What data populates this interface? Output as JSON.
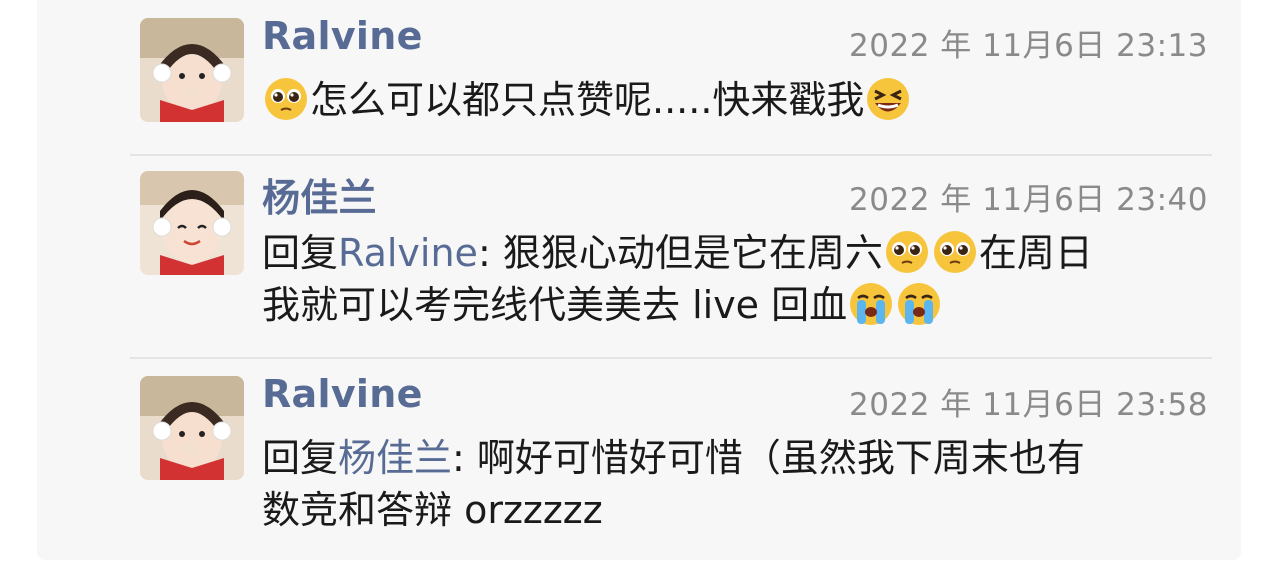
{
  "comments": [
    {
      "name": "Ralvine",
      "time": "2022 年 11月6日 23:13",
      "avatar": "boy-with-earmuffs-avatar",
      "line1": "怎么可以都只点赞呢.....快来戳我",
      "emojis": [
        "pleading-face-emoji",
        "laughing-squint-face-emoji"
      ]
    },
    {
      "name": "杨佳兰",
      "time": "2022 年 11月6日 23:40",
      "avatar": "girl-with-earmuffs-avatar",
      "reply_prefix": "回复",
      "reply_to": "Ralvine",
      "line1": ": 狠狠心动但是它在周六",
      "line1b": "在周日",
      "line2": "我就可以考完线代美美去 live 回血",
      "emojis": [
        "pleading-face-emoji",
        "pleading-face-emoji",
        "loudly-crying-face-emoji",
        "loudly-crying-face-emoji"
      ]
    },
    {
      "name": "Ralvine",
      "time": "2022 年 11月6日 23:58",
      "avatar": "boy-with-earmuffs-avatar",
      "reply_prefix": "回复",
      "reply_to": "杨佳兰",
      "line1": ": 啊好可惜好可惜（虽然我下周末也有",
      "line2": "数竞和答辩 orzzzzz"
    }
  ],
  "colors": {
    "name_link": "#576b95",
    "timestamp": "#8a8a8a",
    "body_text": "#1a1a1a",
    "panel_bg": "#f7f7f7",
    "divider": "#e4e4e4"
  }
}
